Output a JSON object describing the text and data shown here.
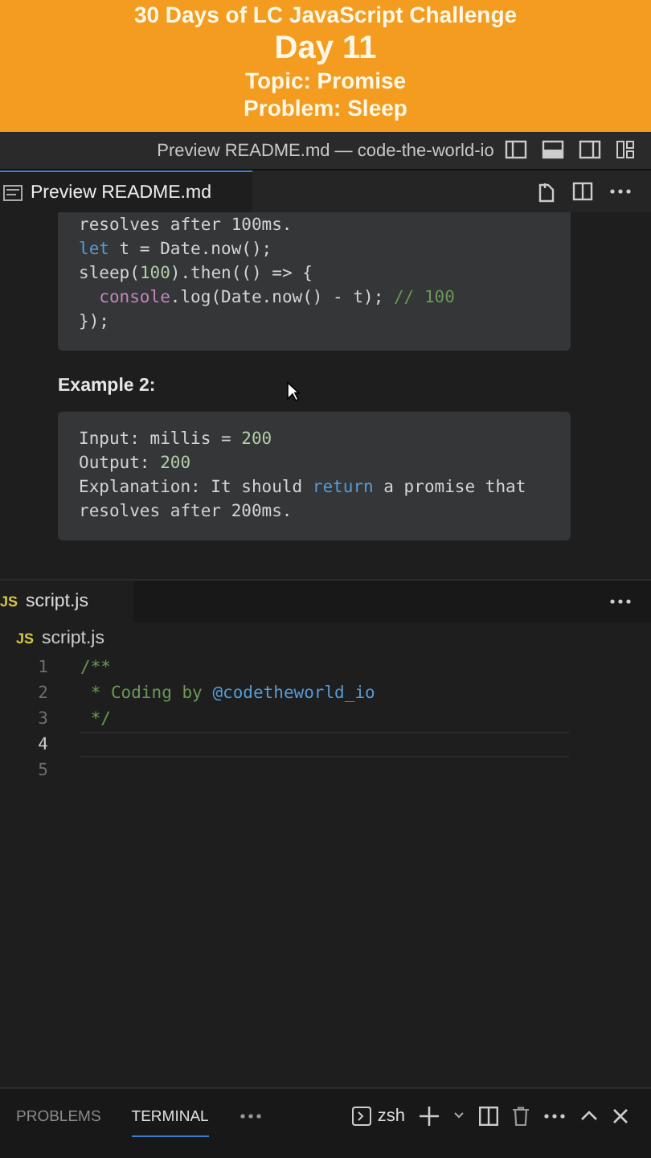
{
  "banner": {
    "title": "30 Days of LC JavaScript Challenge",
    "day": "Day 11",
    "topic": "Topic: Promise",
    "problem": "Problem: Sleep"
  },
  "window": {
    "title": "Preview README.md — code-the-world-io"
  },
  "preview_tab": {
    "label": "Preview README.md",
    "selected": true
  },
  "preview": {
    "blocks": [
      {
        "kind": "code",
        "lines": [
          [
            {
              "t": "resolves after 100ms."
            }
          ],
          [
            {
              "t": "let",
              "color": "#569cd6"
            },
            {
              "t": " t = Date.now();"
            }
          ],
          [
            {
              "t": "sleep("
            },
            {
              "t": "100",
              "color": "#b5cea8"
            },
            {
              "t": ").then(() => {"
            }
          ],
          [
            {
              "t": "  console",
              "color": "#c586c0"
            },
            {
              "t": ".log(Date.now() - t); "
            },
            {
              "t": "// 100",
              "color": "#6a9955"
            }
          ],
          [
            {
              "t": "});"
            }
          ]
        ]
      },
      {
        "kind": "heading",
        "text": "Example 2:"
      },
      {
        "kind": "code",
        "lines": [
          [
            {
              "t": "Input: millis = "
            },
            {
              "t": "200",
              "color": "#b5cea8"
            }
          ],
          [
            {
              "t": "Output: "
            },
            {
              "t": "200",
              "color": "#b5cea8"
            }
          ],
          [
            {
              "t": "Explanation: It should "
            },
            {
              "t": "return",
              "color": "#569cd6"
            },
            {
              "t": " a promise that"
            }
          ],
          [
            {
              "t": "resolves after 200ms."
            }
          ]
        ]
      }
    ]
  },
  "editor_tab": {
    "icon": "JS",
    "label": "script.js",
    "selected": true
  },
  "breadcrumb": {
    "icon": "JS",
    "label": "script.js"
  },
  "code": [
    {
      "num": "1",
      "current": false,
      "tokens": [
        {
          "t": "/**",
          "color": "#6a9955"
        }
      ]
    },
    {
      "num": "2",
      "current": false,
      "tokens": [
        {
          "t": " * Coding by ",
          "color": "#6a9955"
        },
        {
          "t": "@codetheworld_io",
          "color": "#569cd6"
        }
      ]
    },
    {
      "num": "3",
      "current": false,
      "tokens": [
        {
          "t": " */",
          "color": "#6a9955"
        }
      ]
    },
    {
      "num": "4",
      "current": true
    },
    {
      "num": "5",
      "current": false
    }
  ],
  "panel_tabs": [
    {
      "label": "PROBLEMS",
      "selected": false
    },
    {
      "label": "TERMINAL",
      "selected": true
    }
  ],
  "terminal": {
    "shell": "zsh"
  }
}
